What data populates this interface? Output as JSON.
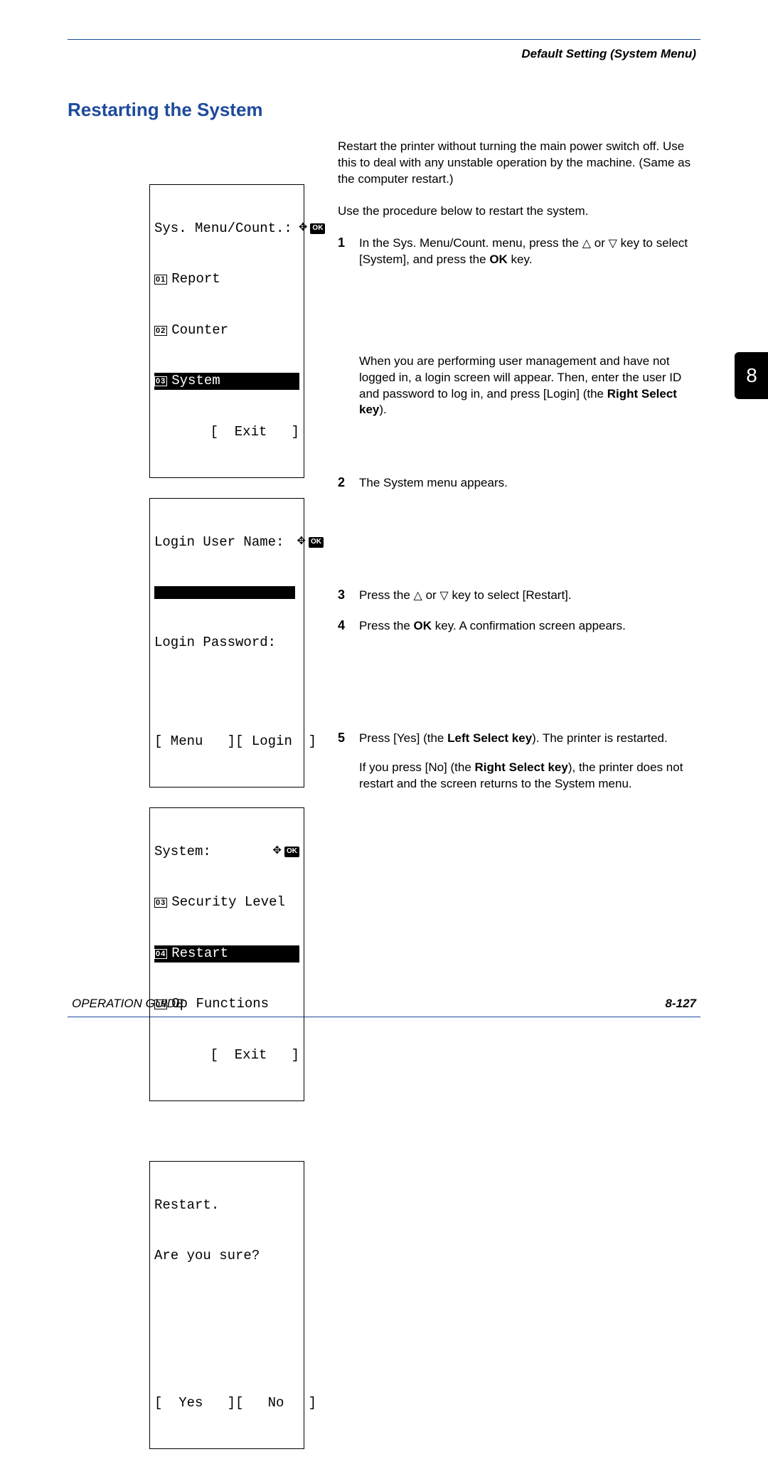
{
  "header": "Default Setting (System Menu)",
  "title": "Restarting the System",
  "intro1": "Restart the printer without turning the main power switch off. Use this to deal with any unstable operation by the machine. (Same as the computer restart.)",
  "intro2": "Use the procedure below to restart the system.",
  "steps": {
    "s1a": "In the Sys. Menu/Count. menu, press the ",
    "s1b": " or ",
    "s1c": " key to select [System], and press the ",
    "s1d": " key.",
    "s1e": "When you are performing user management and have not logged in, a login screen will appear. Then, enter the user ID and password to log in, and press [Login] (the ",
    "s1f": ").",
    "s2": "The System menu appears.",
    "s3a": "Press the ",
    "s3b": " or ",
    "s3c": " key to select [Restart].",
    "s4a": "Press the ",
    "s4b": " key. A confirmation screen appears.",
    "s5a": "Press [Yes] (the ",
    "s5b": "). The printer is restarted.",
    "s5c": "If you press [No] (the ",
    "s5d": "), the printer does not restart and the screen returns to the System menu."
  },
  "keys": {
    "ok": "OK",
    "right_select": "Right Select key",
    "left_select": "Left Select key"
  },
  "lcd1": {
    "title": "Sys. Menu/Count.:",
    "i1n": "01",
    "i1": "Report",
    "i2n": "02",
    "i2": "Counter",
    "i3n": "03",
    "i3": "System",
    "exit": "[  Exit   ]"
  },
  "lcd2": {
    "line1": "Login User Name:",
    "line2": "Login Password:",
    "menu": "[ Menu   ]",
    "login": "[ Login  ]"
  },
  "lcd3": {
    "title": "System:",
    "i1n": "03",
    "i1": "Security Level",
    "i2n": "04",
    "i2": "Restart",
    "i3n": "05",
    "i3": "Op Functions",
    "exit": "[  Exit   ]"
  },
  "lcd4": {
    "line1": "Restart.",
    "line2": "Are you sure?",
    "yes": "[  Yes   ]",
    "no": "[   No   ]"
  },
  "chapter": "8",
  "footer_left": "OPERATION GUIDE",
  "footer_right": "8-127"
}
